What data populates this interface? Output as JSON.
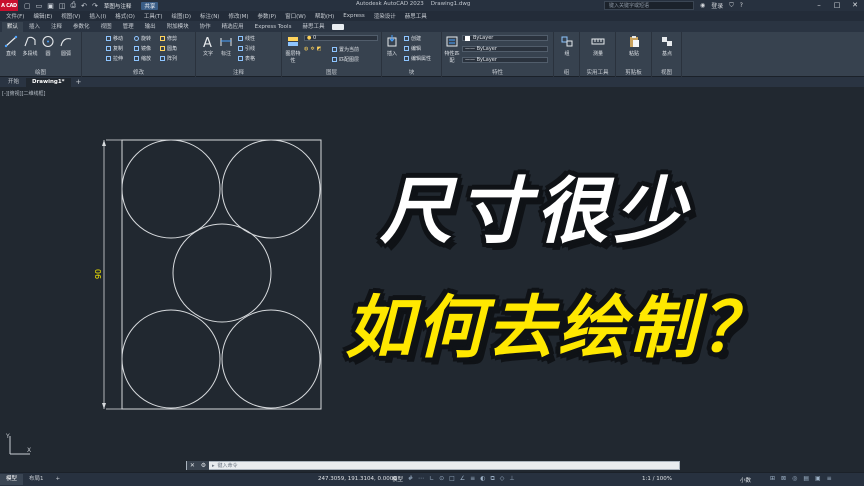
{
  "titlebar": {
    "logo": "A CAD",
    "workspace": "草图与注释",
    "share": "共享",
    "app_title": "Autodesk AutoCAD 2023",
    "doc_title": "Drawing1.dwg",
    "search_placeholder": "键入关键字或短语",
    "login": "登录"
  },
  "menubar": [
    "文件(F)",
    "编辑(E)",
    "视图(V)",
    "插入(I)",
    "格式(O)",
    "工具(T)",
    "绘图(D)",
    "标注(N)",
    "修改(M)",
    "参数(P)",
    "窗口(W)",
    "帮助(H)",
    "Express",
    "渲染设计",
    "赫思工具"
  ],
  "ribbon_tabs": [
    "默认",
    "插入",
    "注释",
    "参数化",
    "视图",
    "管理",
    "输出",
    "附加模块",
    "协作",
    "精选应用",
    "Express Tools",
    "赫思工具"
  ],
  "ribbon": {
    "draw": {
      "label": "绘图",
      "tools": [
        "直线",
        "多段线",
        "圆",
        "圆弧"
      ]
    },
    "modify": {
      "label": "修改",
      "tools": [
        "移动",
        "旋转",
        "修剪",
        "复制",
        "镜像",
        "圆角",
        "拉伸",
        "缩放",
        "阵列"
      ]
    },
    "annotation": {
      "label": "注释",
      "tools": [
        "文字",
        "标注",
        "线性",
        "引线",
        "表格"
      ]
    },
    "layers": {
      "label": "图层",
      "tools": [
        "图层特性",
        "置为当前",
        "匹配图层"
      ],
      "current_layer": "0"
    },
    "block": {
      "label": "块",
      "tools": [
        "插入",
        "创建",
        "编辑",
        "编辑属性"
      ]
    },
    "properties": {
      "label": "特性",
      "tools": [
        "特性匹配"
      ],
      "color": "ByLayer",
      "linetype": "ByLayer",
      "lineweight": "ByLayer"
    },
    "groups": {
      "label": "组",
      "tools": [
        "组"
      ]
    },
    "utilities": {
      "label": "实用工具",
      "tools": [
        "测量"
      ]
    },
    "clipboard": {
      "label": "剪贴板",
      "tools": [
        "粘贴"
      ]
    },
    "view": {
      "label": "视图",
      "tools": [
        "基点"
      ]
    }
  },
  "doc_tabs": [
    "开始",
    "Drawing1*"
  ],
  "viewport_control": "[-][俯视][二维线框]",
  "drawing": {
    "dimension_text": "90",
    "dimension_color": "#f2e600",
    "line_color": "#d7dadd"
  },
  "overlay": {
    "line1": "尺寸很少",
    "line2": "如何去绘制？",
    "line1_color": "#ffffff",
    "line2_color": "#ffe800"
  },
  "ucs": {
    "x_label": "X",
    "y_label": "Y"
  },
  "cmdline": {
    "placeholder": "键入命令"
  },
  "statusbar": {
    "layout_tabs": [
      "模型",
      "布局1"
    ],
    "coordinates": "247.3059, 191.3104, 0.0000",
    "model_label": "模型",
    "scale": "1:1 / 100%",
    "units": "小数"
  }
}
